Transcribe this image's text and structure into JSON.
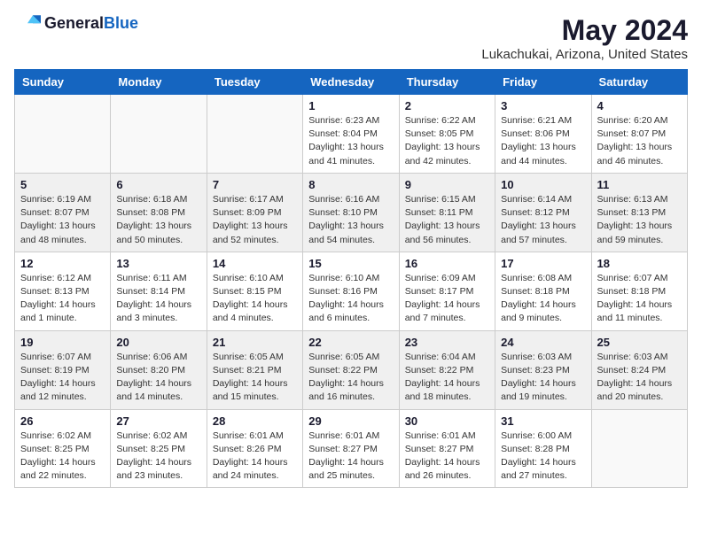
{
  "header": {
    "logo_general": "General",
    "logo_blue": "Blue",
    "month": "May 2024",
    "location": "Lukachukai, Arizona, United States"
  },
  "days_of_week": [
    "Sunday",
    "Monday",
    "Tuesday",
    "Wednesday",
    "Thursday",
    "Friday",
    "Saturday"
  ],
  "weeks": [
    [
      {
        "num": "",
        "sunrise": "",
        "sunset": "",
        "daylight": "",
        "empty": true
      },
      {
        "num": "",
        "sunrise": "",
        "sunset": "",
        "daylight": "",
        "empty": true
      },
      {
        "num": "",
        "sunrise": "",
        "sunset": "",
        "daylight": "",
        "empty": true
      },
      {
        "num": "1",
        "sunrise": "Sunrise: 6:23 AM",
        "sunset": "Sunset: 8:04 PM",
        "daylight": "Daylight: 13 hours and 41 minutes.",
        "empty": false
      },
      {
        "num": "2",
        "sunrise": "Sunrise: 6:22 AM",
        "sunset": "Sunset: 8:05 PM",
        "daylight": "Daylight: 13 hours and 42 minutes.",
        "empty": false
      },
      {
        "num": "3",
        "sunrise": "Sunrise: 6:21 AM",
        "sunset": "Sunset: 8:06 PM",
        "daylight": "Daylight: 13 hours and 44 minutes.",
        "empty": false
      },
      {
        "num": "4",
        "sunrise": "Sunrise: 6:20 AM",
        "sunset": "Sunset: 8:07 PM",
        "daylight": "Daylight: 13 hours and 46 minutes.",
        "empty": false
      }
    ],
    [
      {
        "num": "5",
        "sunrise": "Sunrise: 6:19 AM",
        "sunset": "Sunset: 8:07 PM",
        "daylight": "Daylight: 13 hours and 48 minutes.",
        "empty": false
      },
      {
        "num": "6",
        "sunrise": "Sunrise: 6:18 AM",
        "sunset": "Sunset: 8:08 PM",
        "daylight": "Daylight: 13 hours and 50 minutes.",
        "empty": false
      },
      {
        "num": "7",
        "sunrise": "Sunrise: 6:17 AM",
        "sunset": "Sunset: 8:09 PM",
        "daylight": "Daylight: 13 hours and 52 minutes.",
        "empty": false
      },
      {
        "num": "8",
        "sunrise": "Sunrise: 6:16 AM",
        "sunset": "Sunset: 8:10 PM",
        "daylight": "Daylight: 13 hours and 54 minutes.",
        "empty": false
      },
      {
        "num": "9",
        "sunrise": "Sunrise: 6:15 AM",
        "sunset": "Sunset: 8:11 PM",
        "daylight": "Daylight: 13 hours and 56 minutes.",
        "empty": false
      },
      {
        "num": "10",
        "sunrise": "Sunrise: 6:14 AM",
        "sunset": "Sunset: 8:12 PM",
        "daylight": "Daylight: 13 hours and 57 minutes.",
        "empty": false
      },
      {
        "num": "11",
        "sunrise": "Sunrise: 6:13 AM",
        "sunset": "Sunset: 8:13 PM",
        "daylight": "Daylight: 13 hours and 59 minutes.",
        "empty": false
      }
    ],
    [
      {
        "num": "12",
        "sunrise": "Sunrise: 6:12 AM",
        "sunset": "Sunset: 8:13 PM",
        "daylight": "Daylight: 14 hours and 1 minute.",
        "empty": false
      },
      {
        "num": "13",
        "sunrise": "Sunrise: 6:11 AM",
        "sunset": "Sunset: 8:14 PM",
        "daylight": "Daylight: 14 hours and 3 minutes.",
        "empty": false
      },
      {
        "num": "14",
        "sunrise": "Sunrise: 6:10 AM",
        "sunset": "Sunset: 8:15 PM",
        "daylight": "Daylight: 14 hours and 4 minutes.",
        "empty": false
      },
      {
        "num": "15",
        "sunrise": "Sunrise: 6:10 AM",
        "sunset": "Sunset: 8:16 PM",
        "daylight": "Daylight: 14 hours and 6 minutes.",
        "empty": false
      },
      {
        "num": "16",
        "sunrise": "Sunrise: 6:09 AM",
        "sunset": "Sunset: 8:17 PM",
        "daylight": "Daylight: 14 hours and 7 minutes.",
        "empty": false
      },
      {
        "num": "17",
        "sunrise": "Sunrise: 6:08 AM",
        "sunset": "Sunset: 8:18 PM",
        "daylight": "Daylight: 14 hours and 9 minutes.",
        "empty": false
      },
      {
        "num": "18",
        "sunrise": "Sunrise: 6:07 AM",
        "sunset": "Sunset: 8:18 PM",
        "daylight": "Daylight: 14 hours and 11 minutes.",
        "empty": false
      }
    ],
    [
      {
        "num": "19",
        "sunrise": "Sunrise: 6:07 AM",
        "sunset": "Sunset: 8:19 PM",
        "daylight": "Daylight: 14 hours and 12 minutes.",
        "empty": false
      },
      {
        "num": "20",
        "sunrise": "Sunrise: 6:06 AM",
        "sunset": "Sunset: 8:20 PM",
        "daylight": "Daylight: 14 hours and 14 minutes.",
        "empty": false
      },
      {
        "num": "21",
        "sunrise": "Sunrise: 6:05 AM",
        "sunset": "Sunset: 8:21 PM",
        "daylight": "Daylight: 14 hours and 15 minutes.",
        "empty": false
      },
      {
        "num": "22",
        "sunrise": "Sunrise: 6:05 AM",
        "sunset": "Sunset: 8:22 PM",
        "daylight": "Daylight: 14 hours and 16 minutes.",
        "empty": false
      },
      {
        "num": "23",
        "sunrise": "Sunrise: 6:04 AM",
        "sunset": "Sunset: 8:22 PM",
        "daylight": "Daylight: 14 hours and 18 minutes.",
        "empty": false
      },
      {
        "num": "24",
        "sunrise": "Sunrise: 6:03 AM",
        "sunset": "Sunset: 8:23 PM",
        "daylight": "Daylight: 14 hours and 19 minutes.",
        "empty": false
      },
      {
        "num": "25",
        "sunrise": "Sunrise: 6:03 AM",
        "sunset": "Sunset: 8:24 PM",
        "daylight": "Daylight: 14 hours and 20 minutes.",
        "empty": false
      }
    ],
    [
      {
        "num": "26",
        "sunrise": "Sunrise: 6:02 AM",
        "sunset": "Sunset: 8:25 PM",
        "daylight": "Daylight: 14 hours and 22 minutes.",
        "empty": false
      },
      {
        "num": "27",
        "sunrise": "Sunrise: 6:02 AM",
        "sunset": "Sunset: 8:25 PM",
        "daylight": "Daylight: 14 hours and 23 minutes.",
        "empty": false
      },
      {
        "num": "28",
        "sunrise": "Sunrise: 6:01 AM",
        "sunset": "Sunset: 8:26 PM",
        "daylight": "Daylight: 14 hours and 24 minutes.",
        "empty": false
      },
      {
        "num": "29",
        "sunrise": "Sunrise: 6:01 AM",
        "sunset": "Sunset: 8:27 PM",
        "daylight": "Daylight: 14 hours and 25 minutes.",
        "empty": false
      },
      {
        "num": "30",
        "sunrise": "Sunrise: 6:01 AM",
        "sunset": "Sunset: 8:27 PM",
        "daylight": "Daylight: 14 hours and 26 minutes.",
        "empty": false
      },
      {
        "num": "31",
        "sunrise": "Sunrise: 6:00 AM",
        "sunset": "Sunset: 8:28 PM",
        "daylight": "Daylight: 14 hours and 27 minutes.",
        "empty": false
      },
      {
        "num": "",
        "sunrise": "",
        "sunset": "",
        "daylight": "",
        "empty": true
      }
    ]
  ]
}
